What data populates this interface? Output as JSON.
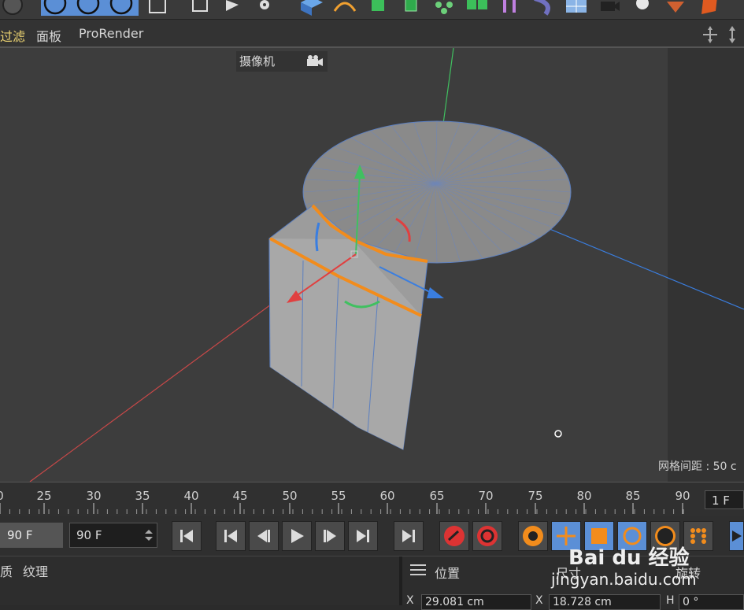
{
  "menubar": {
    "items": [
      "过滤",
      "面板",
      "ProRender"
    ]
  },
  "viewport": {
    "camera_label": "摄像机",
    "grid_info": "网格间距 : 50 c"
  },
  "timeline": {
    "ticks": [
      "0",
      "25",
      "30",
      "35",
      "40",
      "45",
      "50",
      "55",
      "60",
      "65",
      "70",
      "75",
      "80",
      "85",
      "90"
    ],
    "current_frame": "1 F"
  },
  "transport": {
    "end_frame": "90 F",
    "end_frame_2": "90 F"
  },
  "bottom": {
    "left_tabs": [
      "质",
      "纹理"
    ],
    "coord_header": "位置",
    "size_header": "尺寸",
    "rot_header": "旋转",
    "x_label": "X",
    "x2_label": "X",
    "h_label": "H",
    "pos_x": "29.081 cm",
    "size_x": "18.728 cm",
    "rot_h": "0 °"
  },
  "watermark": {
    "brand": "Bai du 经验",
    "url": "jingyan.baidu.com"
  },
  "colors": {
    "accent_orange": "#f28c1c",
    "axis_red": "#e04040",
    "axis_green": "#40c060",
    "axis_blue": "#3a7ee0",
    "selected_blue": "#5b8fd6"
  }
}
